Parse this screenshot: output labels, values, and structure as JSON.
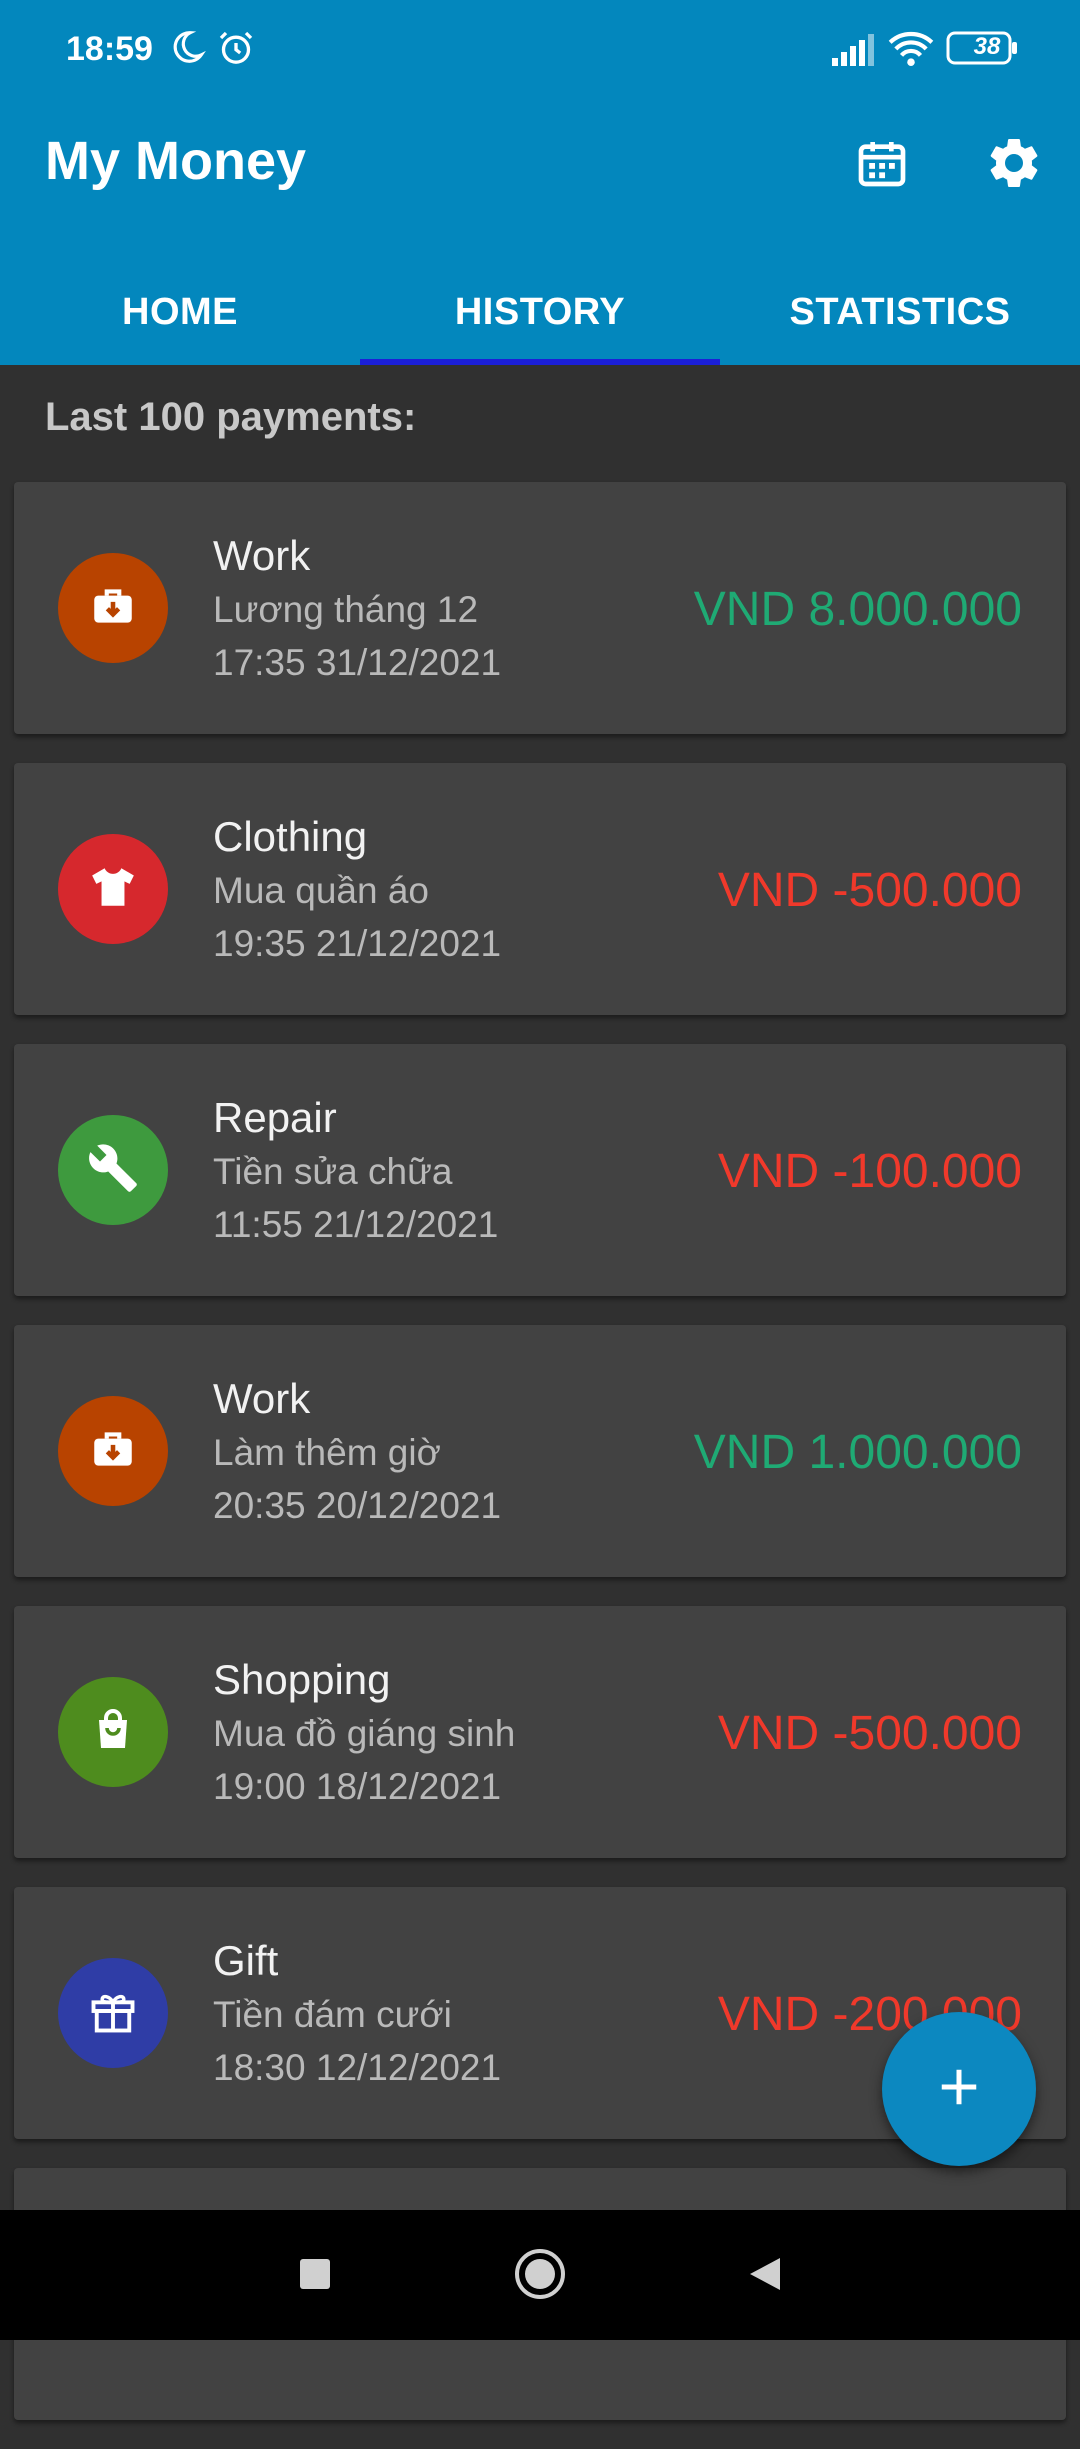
{
  "status_bar": {
    "time": "18:59",
    "battery": "38",
    "icons": [
      "moon-icon",
      "alarm-icon",
      "signal-icon",
      "wifi-icon",
      "battery-icon"
    ]
  },
  "app": {
    "title": "My Money",
    "actions": [
      "calendar-icon",
      "gear-icon"
    ],
    "tabs": [
      {
        "label": "HOME",
        "active": false
      },
      {
        "label": "HISTORY",
        "active": true
      },
      {
        "label": "STATISTICS",
        "active": false
      }
    ]
  },
  "history": {
    "title": "Last 100 payments:",
    "items": [
      {
        "category": "Work",
        "note": "Lương tháng 12",
        "datetime": "17:35 31/12/2021",
        "amount": "VND 8.000.000",
        "type": "income",
        "icon": "briefcase-icon",
        "icon_color": "#b84300"
      },
      {
        "category": "Clothing",
        "note": "Mua quần áo",
        "datetime": "19:35 21/12/2021",
        "amount": "VND -500.000",
        "type": "expense",
        "icon": "shirt-icon",
        "icon_color": "#d6282d"
      },
      {
        "category": "Repair",
        "note": "Tiền sửa chữa",
        "datetime": "11:55 21/12/2021",
        "amount": "VND -100.000",
        "type": "expense",
        "icon": "wrench-icon",
        "icon_color": "#3e9a3e"
      },
      {
        "category": "Work",
        "note": "Làm thêm giờ",
        "datetime": "20:35 20/12/2021",
        "amount": "VND 1.000.000",
        "type": "income",
        "icon": "briefcase-icon",
        "icon_color": "#b84300"
      },
      {
        "category": "Shopping",
        "note": "Mua đồ giáng sinh",
        "datetime": "19:00 18/12/2021",
        "amount": "VND -500.000",
        "type": "expense",
        "icon": "shopping-bag-icon",
        "icon_color": "#4e8c1e"
      },
      {
        "category": "Gift",
        "note": "Tiền đám cưới",
        "datetime": "18:30 12/12/2021",
        "amount": "VND -200.000",
        "type": "expense",
        "icon": "gift-icon",
        "icon_color": "#2f3da6"
      }
    ]
  },
  "colors": {
    "primary": "#0387bd",
    "income": "#1faa74",
    "expense": "#f0392b",
    "tab_indicator": "#1b1fd8",
    "card": "#424242",
    "background": "#303030"
  },
  "fab": {
    "icon": "plus-icon"
  },
  "nav_bar": {
    "buttons": [
      "recents-square-icon",
      "home-circle-icon",
      "back-triangle-icon"
    ]
  }
}
